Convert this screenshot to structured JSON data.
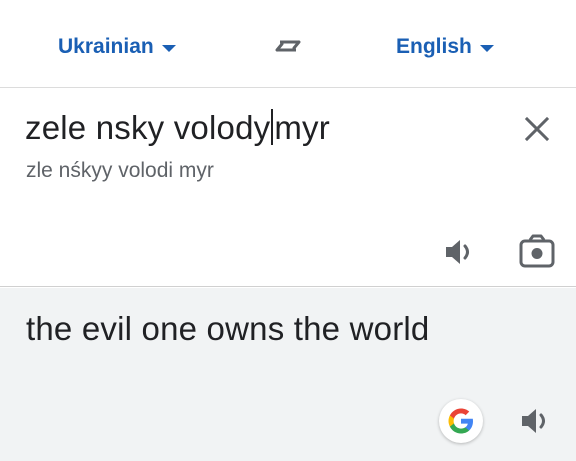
{
  "languages": {
    "source": "Ukrainian",
    "target": "English",
    "swap_icon": "swap-arrows-icon"
  },
  "input": {
    "text_before_cursor": "zele nsky volody",
    "text_after_cursor": "myr",
    "transliteration": "zle nśkyy volodi myr",
    "clear_icon": "close-icon",
    "speaker_icon": "speaker-icon",
    "camera_icon": "camera-icon"
  },
  "output": {
    "text": "the evil one owns the world",
    "brand_icon": "google-g-icon",
    "speaker_icon": "speaker-icon"
  },
  "colors": {
    "accent": "#1a5fb4",
    "icon": "#5f6368",
    "output_bg": "#f1f3f4"
  }
}
